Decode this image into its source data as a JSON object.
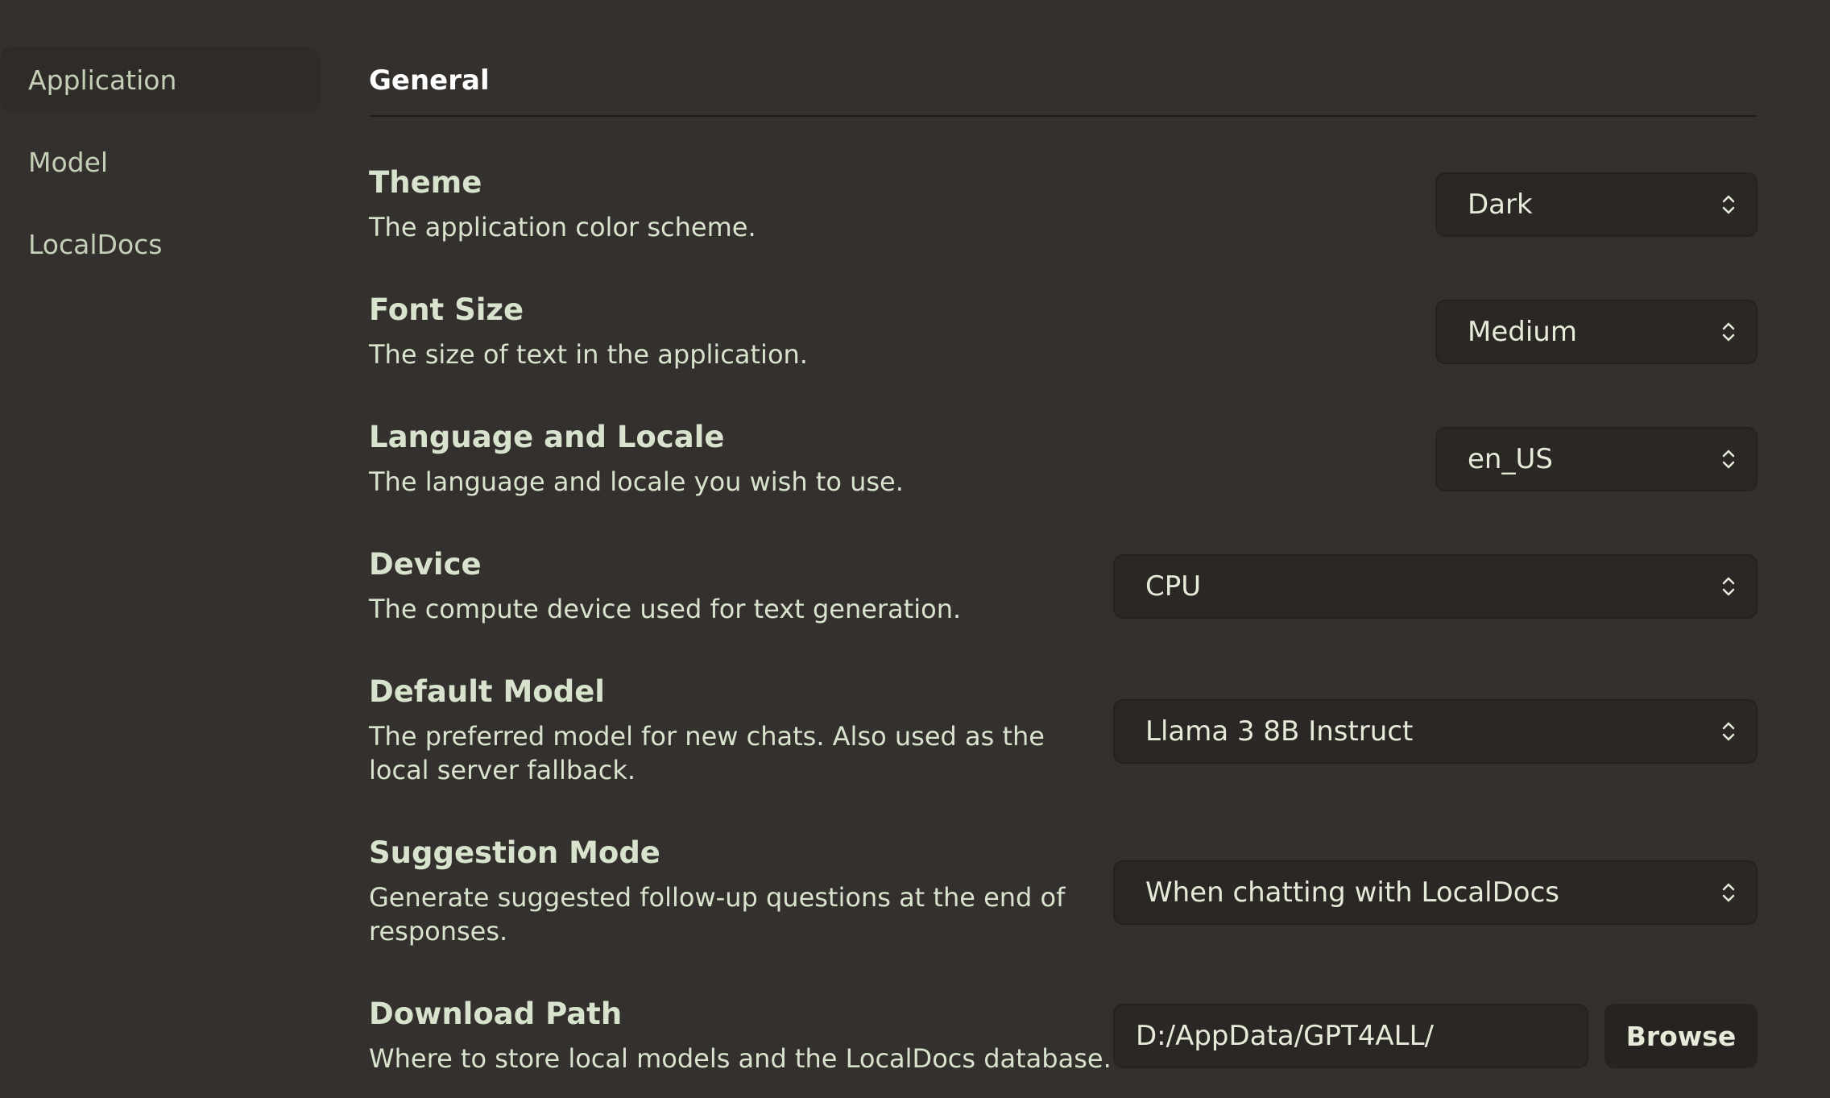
{
  "sidebar": {
    "items": [
      {
        "label": "Application",
        "active": true
      },
      {
        "label": "Model",
        "active": false
      },
      {
        "label": "LocalDocs",
        "active": false
      }
    ]
  },
  "main": {
    "section_title": "General",
    "settings": {
      "theme": {
        "title": "Theme",
        "description": "The application color scheme.",
        "value": "Dark"
      },
      "font_size": {
        "title": "Font Size",
        "description": "The size of text in the application.",
        "value": "Medium"
      },
      "language": {
        "title": "Language and Locale",
        "description": "The language and locale you wish to use.",
        "value": "en_US"
      },
      "device": {
        "title": "Device",
        "description": "The compute device used for text generation.",
        "value": "CPU"
      },
      "default_model": {
        "title": "Default Model",
        "description": "The preferred model for new chats. Also used as the local server fallback.",
        "value": "Llama 3 8B Instruct"
      },
      "suggestion_mode": {
        "title": "Suggestion Mode",
        "description": "Generate suggested follow-up questions at the end of responses.",
        "value": "When chatting with LocalDocs"
      },
      "download_path": {
        "title": "Download Path",
        "description": "Where to store local models and the LocalDocs database.",
        "value": "D:/AppData/GPT4ALL/",
        "button_label": "Browse"
      }
    }
  },
  "colors": {
    "background": "#34302d",
    "sidebar_active": "#2f2b28",
    "control_bg": "#2a2725",
    "label_text": "#d8e3ce",
    "nav_text": "#c4cfb7"
  },
  "icons": {
    "select_arrow": "chevron-up-down-icon"
  }
}
